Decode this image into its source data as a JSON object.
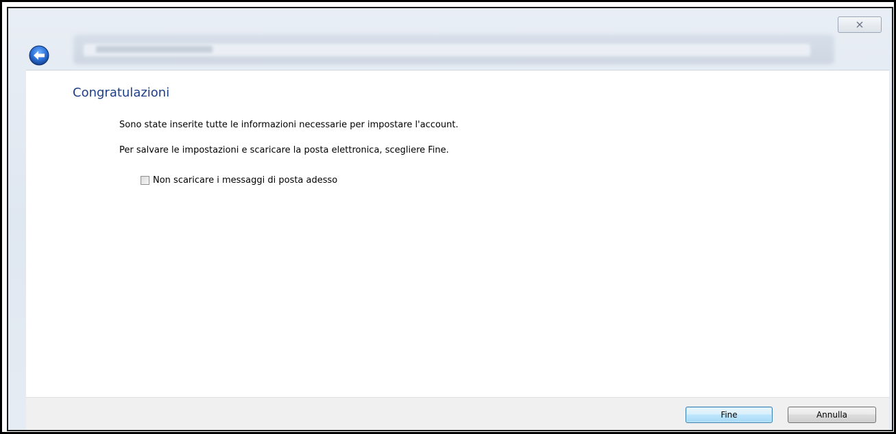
{
  "window": {
    "close_glyph": "✕",
    "back_icon": "back-arrow-icon"
  },
  "main": {
    "title": "Congratulazioni",
    "info_line_1": "Sono state inserite tutte le informazioni necessarie per impostare l'account.",
    "info_line_2": "Per salvare le impostazioni e scaricare la posta elettronica, scegliere Fine.",
    "checkbox": {
      "label": "Non scaricare i messaggi di posta adesso",
      "checked": false
    }
  },
  "footer": {
    "finish_label": "Fine",
    "cancel_label": "Annulla"
  },
  "colors": {
    "title": "#1e3f87",
    "back_button": "#2a6fd6",
    "default_button_border": "#3c7fb1"
  }
}
